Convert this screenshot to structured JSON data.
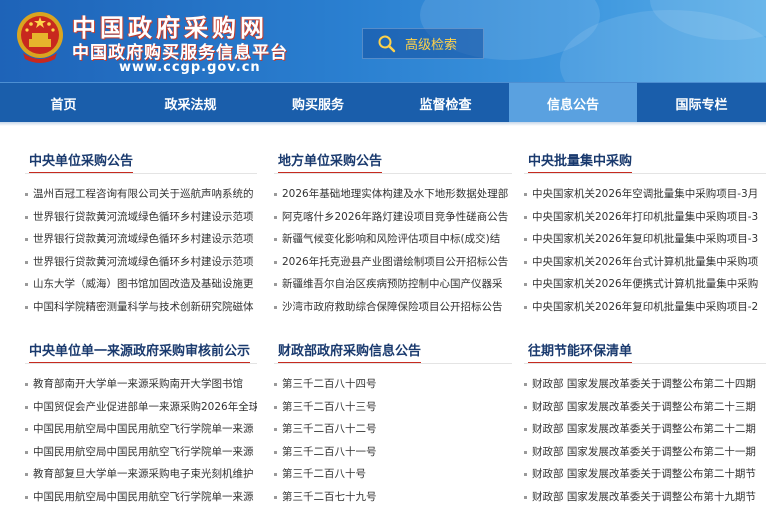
{
  "header": {
    "site_title": "中国政府采购网",
    "site_subtitle": "中国政府购买服务信息平台",
    "site_url": "www.ccgp.gov.cn",
    "advanced_search_label": "高级检索"
  },
  "nav": {
    "active_index": 4,
    "items": [
      {
        "label": "首页"
      },
      {
        "label": "政采法规"
      },
      {
        "label": "购买服务"
      },
      {
        "label": "监督检查"
      },
      {
        "label": "信息公告"
      },
      {
        "label": "国际专栏"
      }
    ]
  },
  "sections": {
    "central_unit": {
      "title": "中央单位采购公告",
      "items": [
        "温州百冠工程咨询有限公司关于巡航声呐系统的",
        "世界银行贷款黄河流域绿色循环乡村建设示范项",
        "世界银行贷款黄河流域绿色循环乡村建设示范项",
        "世界银行贷款黄河流域绿色循环乡村建设示范项",
        "山东大学（威海）图书馆加固改造及基础设施更",
        "中国科学院精密测量科学与技术创新研究院磁体"
      ]
    },
    "local_unit": {
      "title": "地方单位采购公告",
      "items": [
        "2026年基础地理实体构建及水下地形数据处理部",
        "阿克喀什乡2026年路灯建设项目竞争性磋商公告",
        "新疆气候变化影响和风险评估项目中标(成交)结",
        "2026年托克逊县产业图谱绘制项目公开招标公告",
        "新疆维吾尔自治区疾病预防控制中心国产仪器采",
        "沙湾市政府救助综合保障保险项目公开招标公告"
      ]
    },
    "central_batch": {
      "title": "中央批量集中采购",
      "items": [
        "中央国家机关2026年空调批量集中采购项目-3月",
        "中央国家机关2026年打印机批量集中采购项目-3",
        "中央国家机关2026年复印机批量集中采购项目-3",
        "中央国家机关2026年台式计算机批量集中采购项",
        "中央国家机关2026年便携式计算机批量集中采购",
        "中央国家机关2026年复印机批量集中采购项目-2"
      ]
    },
    "single_source": {
      "title": "中央单位单一来源政府采购审核前公示",
      "items": [
        "教育部南开大学单一来源采购南开大学图书馆",
        "中国贸促会产业促进部单一来源采购2026年全球",
        "中国民用航空局中国民用航空飞行学院单一来源",
        "中国民用航空局中国民用航空飞行学院单一来源",
        "教育部复旦大学单一来源采购电子束光刻机维护",
        "中国民用航空局中国民用航空飞行学院单一来源"
      ]
    },
    "mof_info": {
      "title": "财政部政府采购信息公告",
      "items": [
        "第三千二百八十四号",
        "第三千二百八十三号",
        "第三千二百八十二号",
        "第三千二百八十一号",
        "第三千二百八十号",
        "第三千二百七十九号"
      ]
    },
    "energy_saving": {
      "title": "往期节能环保清单",
      "items": [
        "财政部 国家发展改革委关于调整公布第二十四期",
        "财政部 国家发展改革委关于调整公布第二十三期",
        "财政部 国家发展改革委关于调整公布第二十二期",
        "财政部 国家发展改革委关于调整公布第二十一期",
        "财政部 国家发展改革委关于调整公布第二十期节",
        "财政部 国家发展改革委关于调整公布第十九期节"
      ]
    }
  },
  "colors": {
    "header_blue": "#2a7fd0",
    "nav_blue": "#1a5eab",
    "nav_active": "#5aa1e0",
    "title_red_underline": "#c62a1f",
    "search_text": "#ffd24a"
  },
  "icons": {
    "emblem": "national-emblem-icon",
    "search": "search-icon"
  }
}
